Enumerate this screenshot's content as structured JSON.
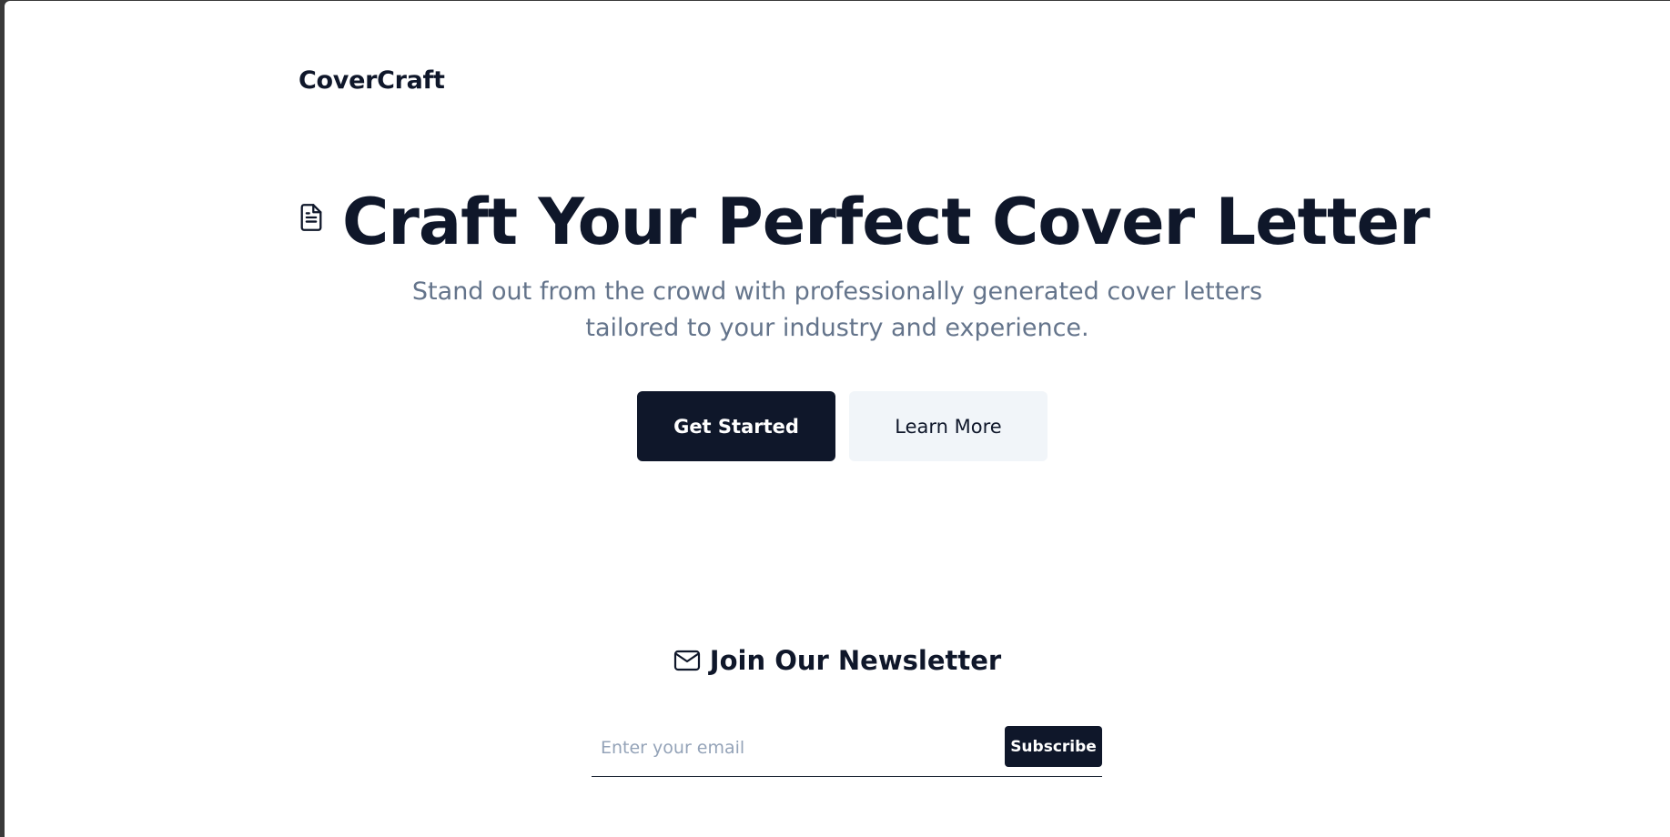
{
  "header": {
    "brand": "CoverCraft"
  },
  "hero": {
    "icon": "document-icon",
    "title": "Craft Your Perfect Cover Letter",
    "subtitle_lines": [
      "Stand out from the crowd with professionally generated cover letters",
      "tailored to your industry and experience."
    ],
    "primary_button": "Get Started",
    "secondary_button": "Learn More"
  },
  "newsletter": {
    "icon": "mail-icon",
    "title": "Join Our Newsletter",
    "email_placeholder": "Enter your email",
    "email_value": "",
    "subscribe_label": "Subscribe"
  },
  "colors": {
    "primary": "#0f172a",
    "muted_text": "#64748b",
    "secondary_bg": "#f1f5f9",
    "background": "#ffffff"
  }
}
